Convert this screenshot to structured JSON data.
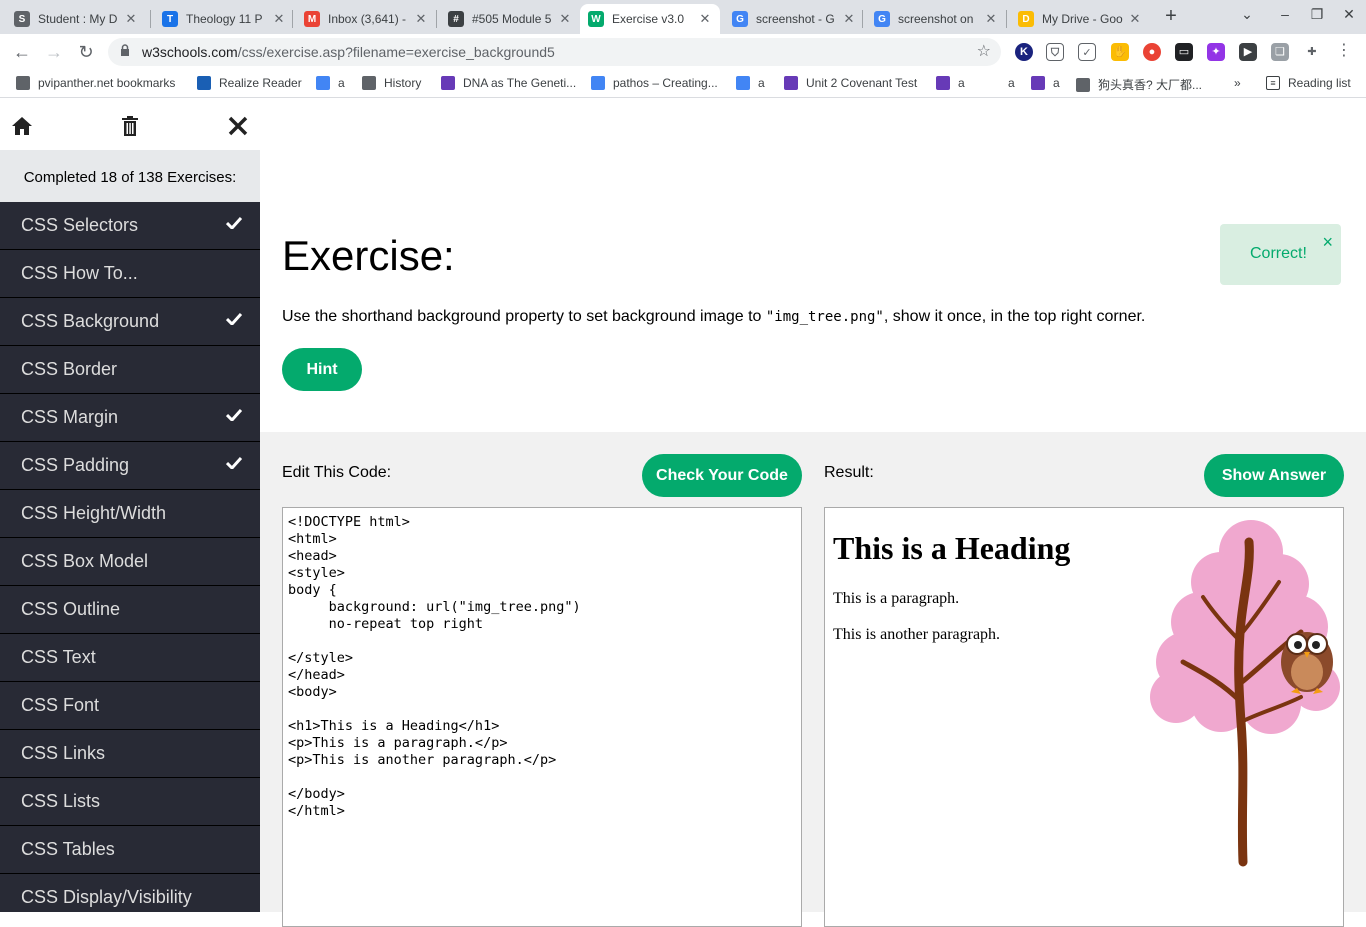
{
  "tabs": [
    {
      "title": "Student : My D",
      "fav": "S",
      "color": "#5f6368"
    },
    {
      "title": "Theology 11 P",
      "fav": "T",
      "color": "#1a73e8"
    },
    {
      "title": "Inbox (3,641) -",
      "fav": "M",
      "color": "#ea4335"
    },
    {
      "title": "#505 Module 5",
      "fav": "#",
      "color": "#3c4043"
    },
    {
      "title": "Exercise v3.0",
      "fav": "W",
      "color": "#04aa6d"
    },
    {
      "title": "screenshot - G",
      "fav": "G",
      "color": "#4285f4"
    },
    {
      "title": "screenshot on",
      "fav": "G",
      "color": "#4285f4"
    },
    {
      "title": "My Drive - Goo",
      "fav": "D",
      "color": "#fbbc04"
    }
  ],
  "address": {
    "host": "w3schools.com",
    "path": "/css/exercise.asp?filename=exercise_background5"
  },
  "bookmarks": [
    {
      "label": "pvipanther.net bookmarks",
      "color": "#5f6368"
    },
    {
      "label": "Realize Reader",
      "color": "#1a5fb4"
    },
    {
      "label": "a",
      "color": "#4285f4"
    },
    {
      "label": "History",
      "color": "#5f6368"
    },
    {
      "label": "DNA as The Geneti...",
      "color": "#673ab7"
    },
    {
      "label": "pathos – Creating...",
      "color": "#4285f4"
    },
    {
      "label": "a",
      "color": "#4285f4"
    },
    {
      "label": "Unit 2 Covenant Test",
      "color": "#673ab7"
    },
    {
      "label": "a",
      "color": "#673ab7"
    },
    {
      "label": "a",
      "color": "#ffffff"
    },
    {
      "label": "a",
      "color": "#673ab7"
    },
    {
      "label": "狗头真香? 大厂都...",
      "color": "#5f6368"
    }
  ],
  "bookmarks_more": "»",
  "reading_list": "Reading list",
  "sidebar": {
    "status": "Completed 18 of 138 Exercises:",
    "items": [
      {
        "label": "CSS Selectors",
        "done": true
      },
      {
        "label": "CSS How To...",
        "done": false
      },
      {
        "label": "CSS Background",
        "done": true
      },
      {
        "label": "CSS Border",
        "done": false
      },
      {
        "label": "CSS Margin",
        "done": true
      },
      {
        "label": "CSS Padding",
        "done": true
      },
      {
        "label": "CSS Height/Width",
        "done": false
      },
      {
        "label": "CSS Box Model",
        "done": false
      },
      {
        "label": "CSS Outline",
        "done": false
      },
      {
        "label": "CSS Text",
        "done": false
      },
      {
        "label": "CSS Font",
        "done": false
      },
      {
        "label": "CSS Links",
        "done": false
      },
      {
        "label": "CSS Lists",
        "done": false
      },
      {
        "label": "CSS Tables",
        "done": false
      },
      {
        "label": "CSS Display/Visibility",
        "done": false
      }
    ]
  },
  "exercise": {
    "title": "Exercise:",
    "desc_before": "Use the shorthand background property to set background image to ",
    "desc_code": "\"img_tree.png\"",
    "desc_after": ", show it once, in the top right corner.",
    "hint": "Hint",
    "correct": "Correct!",
    "close": "×"
  },
  "editor": {
    "label": "Edit This Code:",
    "check": "Check Your Code",
    "code": "<!DOCTYPE html>\n<html>\n<head>\n<style>\nbody {\n     background: url(\"img_tree.png\")\n     no-repeat top right\n\n</style>\n</head>\n<body>\n\n<h1>This is a Heading</h1>\n<p>This is a paragraph.</p>\n<p>This is another paragraph.</p>\n\n</body>\n</html>"
  },
  "result": {
    "label": "Result:",
    "answer": "Show Answer",
    "heading": "This is a Heading",
    "p1": "This is a paragraph.",
    "p2": "This is another paragraph."
  },
  "colors": {
    "accent": "#04aa6d",
    "sidebar": "#282a35",
    "correct_bg": "#d9eee1",
    "tree_pink": "#f0a8cf",
    "tree_trunk": "#7a3410"
  }
}
